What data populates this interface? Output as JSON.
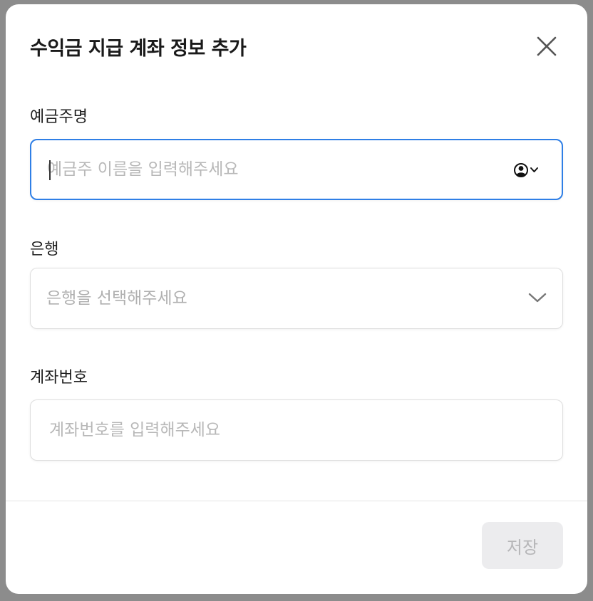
{
  "modal": {
    "title": "수익금 지급 계좌 정보 추가",
    "close_icon": "close-icon"
  },
  "fields": {
    "holder": {
      "label": "예금주명",
      "placeholder": "예금주 이름을 입력해주세요",
      "value": "",
      "autofill_icon": "person-circle-icon",
      "focused": true
    },
    "bank": {
      "label": "은행",
      "placeholder": "은행을 선택해주세요",
      "icon": "chevron-down-icon"
    },
    "account": {
      "label": "계좌번호",
      "placeholder": "계좌번호를 입력해주세요",
      "value": ""
    }
  },
  "footer": {
    "save_label": "저장",
    "save_enabled": false
  },
  "colors": {
    "focus_border": "#2f7fe6",
    "backdrop": "#8c8c8c",
    "disabled_button_bg": "#ececee",
    "disabled_button_text": "#b6b6b8"
  }
}
